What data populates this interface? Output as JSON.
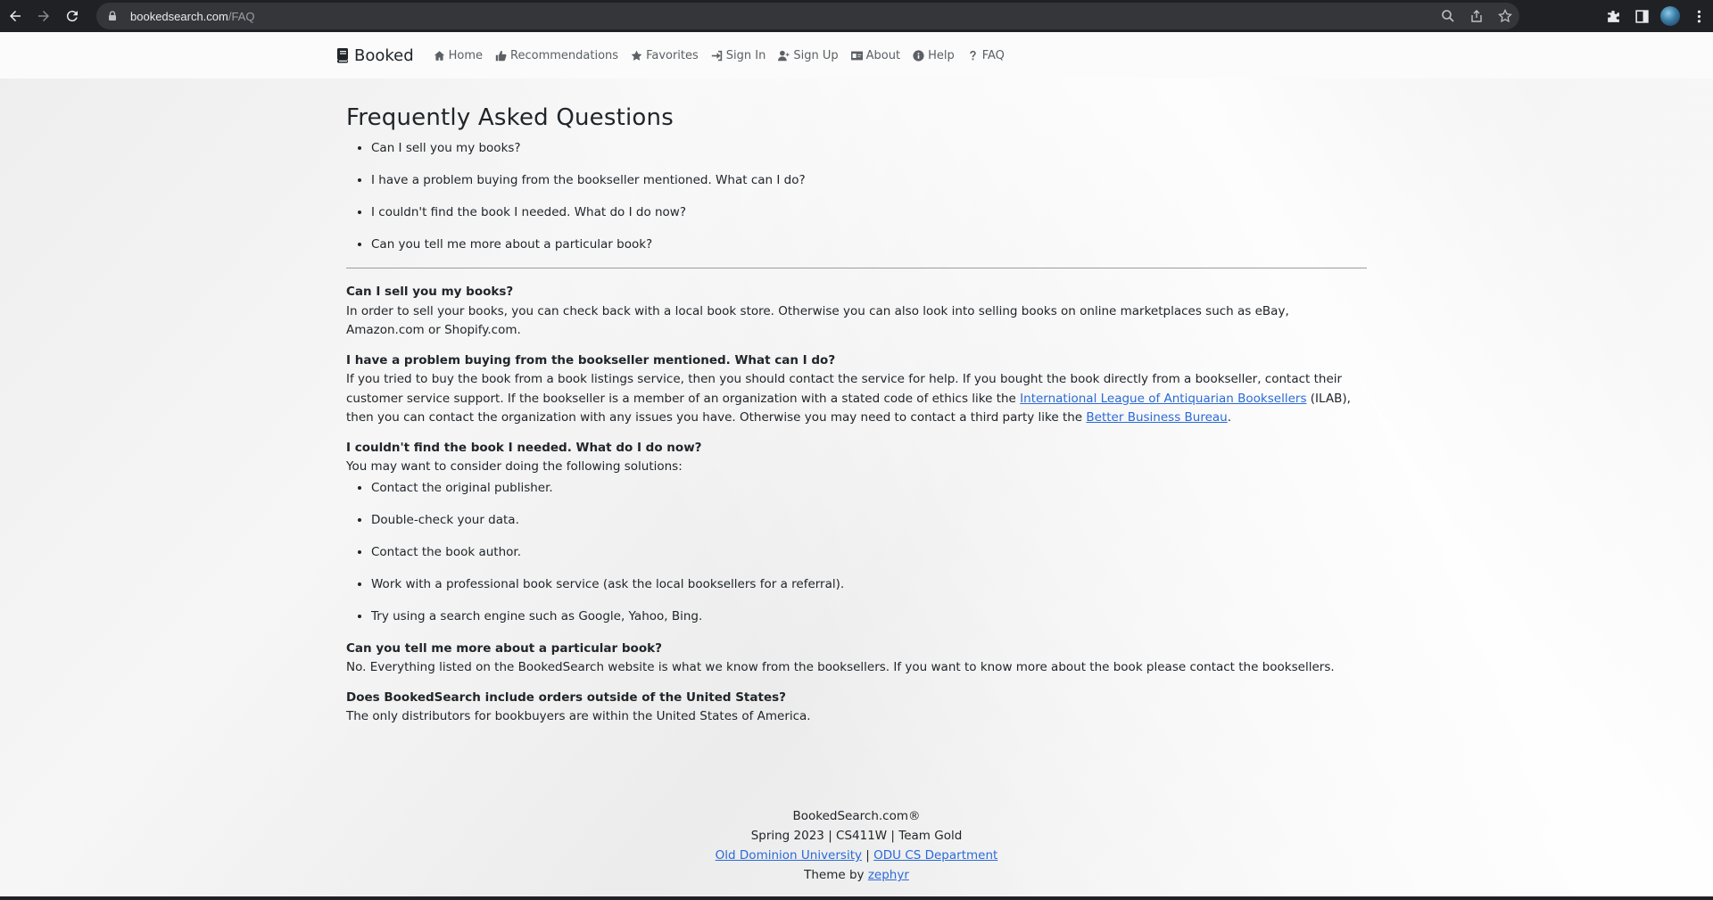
{
  "browser": {
    "url_domain": "bookedsearch.com",
    "url_path": "/FAQ"
  },
  "navbar": {
    "brand": "Booked",
    "links": [
      {
        "label": "Home",
        "icon": "home-icon"
      },
      {
        "label": "Recommendations",
        "icon": "thumbs-up-icon"
      },
      {
        "label": "Favorites",
        "icon": "star-icon"
      },
      {
        "label": "Sign In",
        "icon": "sign-in-icon"
      },
      {
        "label": "Sign Up",
        "icon": "user-plus-icon"
      },
      {
        "label": "About",
        "icon": "id-card-icon"
      },
      {
        "label": "Help",
        "icon": "info-circle-icon"
      },
      {
        "label": "FAQ",
        "icon": "question-icon"
      }
    ]
  },
  "main": {
    "title": "Frequently Asked Questions",
    "toc": [
      "Can I sell you my books?",
      "I have a problem buying from the bookseller mentioned. What can I do?",
      "I couldn't find the book I needed. What do I do now?",
      "Can you tell me more about a particular book?"
    ],
    "faq1": {
      "q": "Can I sell you my books?",
      "a": "In order to sell your books, you can check back with a local book store. Otherwise you can also look into selling books on online marketplaces such as eBay, Amazon.com or Shopify.com."
    },
    "faq2": {
      "q": "I have a problem buying from the bookseller mentioned. What can I do?",
      "a_part1": "If you tried to buy the book from a book listings service, then you should contact the service for help. If you bought the book directly from a bookseller, contact their customer service support. If the bookseller is a member of an organization with a stated code of ethics like the ",
      "link1": "International League of Antiquarian Booksellers",
      "a_part2": " (ILAB), then you can contact the organization with any issues you have. Otherwise you may need to contact a third party like the ",
      "link2": "Better Business Bureau",
      "a_part3": "."
    },
    "faq3": {
      "q": "I couldn't find the book I needed. What do I do now?",
      "a": "You may want to consider doing the following solutions:",
      "solutions": [
        "Contact the original publisher.",
        "Double-check your data.",
        "Contact the book author.",
        "Work with a professional book service (ask the local booksellers for a referral).",
        "Try using a search engine such as Google, Yahoo, Bing."
      ]
    },
    "faq4": {
      "q": "Can you tell me more about a particular book?",
      "a": "No. Everything listed on the BookedSearch website is what we know from the booksellers. If you want to know more about the book please contact the booksellers."
    },
    "faq5": {
      "q": "Does BookedSearch include orders outside of the United States?",
      "a": "The only distributors for bookbuyers are within the United States of America."
    }
  },
  "footer": {
    "line1": "BookedSearch.com®",
    "line2": "Spring 2023 | CS411W | Team Gold",
    "link_odu": "Old Dominion University",
    "separator": " | ",
    "link_dept": "ODU CS Department",
    "theme_prefix": "Theme by ",
    "theme_link": "zephyr"
  },
  "colors": {
    "link": "#2a6ad8",
    "chrome_bg": "#202124",
    "omnibox_bg": "#35363a"
  }
}
